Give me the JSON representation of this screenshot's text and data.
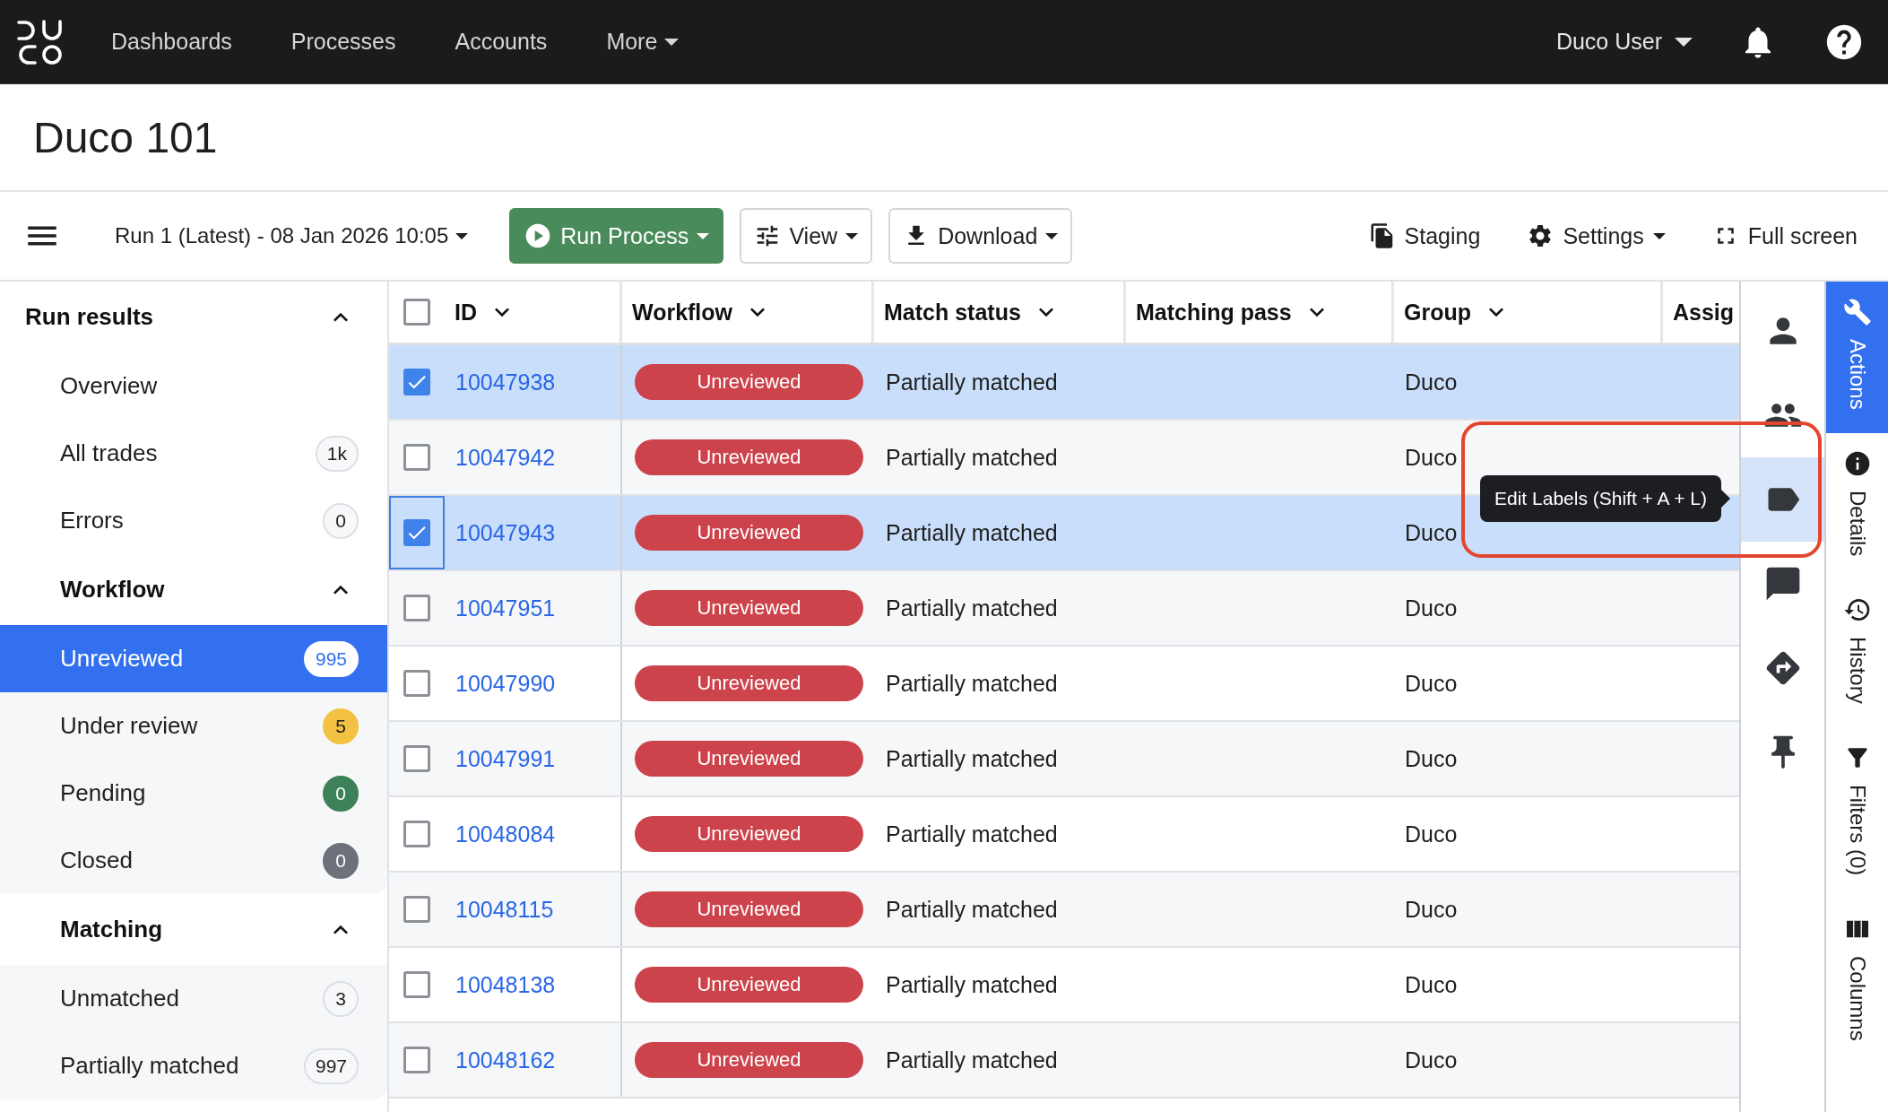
{
  "top_nav": {
    "links": [
      {
        "label": "Dashboards",
        "has_menu": false
      },
      {
        "label": "Processes",
        "has_menu": false
      },
      {
        "label": "Accounts",
        "has_menu": false
      },
      {
        "label": "More",
        "has_menu": true
      }
    ],
    "user_menu": {
      "label": "Duco User",
      "has_menu": true
    }
  },
  "page_title": "Duco 101",
  "toolbar": {
    "run_selector": {
      "label": "Run 1 (Latest) - 08 Jan 2026 10:05",
      "has_menu": true
    },
    "buttons": [
      {
        "label": "Run Process",
        "kind": "primary",
        "has_menu": true
      },
      {
        "label": "View",
        "kind": "outline",
        "has_menu": true
      },
      {
        "label": "Download",
        "kind": "outline",
        "has_menu": true
      }
    ],
    "actions": [
      {
        "label": "Staging",
        "has_menu": false
      },
      {
        "label": "Settings",
        "has_menu": true
      },
      {
        "label": "Full screen",
        "has_menu": false
      }
    ]
  },
  "sidebar": {
    "title": "Run results",
    "expanded": true,
    "children": [
      {
        "kind": "item",
        "label": "Overview",
        "selected": false
      },
      {
        "kind": "item",
        "label": "All trades",
        "count": "1k",
        "selected": false
      },
      {
        "kind": "item",
        "label": "Errors",
        "count": "0",
        "selected": false
      },
      {
        "kind": "group",
        "label": "Workflow",
        "expanded": true,
        "children": [
          {
            "kind": "item",
            "label": "Unreviewed",
            "count": "995",
            "selected": true
          },
          {
            "kind": "item",
            "label": "Under review",
            "count": "5",
            "color": "#f4c242",
            "selected": false
          },
          {
            "kind": "item",
            "label": "Pending",
            "count": "0",
            "color": "#3d8158",
            "selected": false
          },
          {
            "kind": "item",
            "label": "Closed",
            "count": "0",
            "color": "#6c717a",
            "selected": false
          }
        ]
      },
      {
        "kind": "group",
        "label": "Matching",
        "expanded": true,
        "children": [
          {
            "kind": "item",
            "label": "Unmatched",
            "count": "3",
            "selected": false
          },
          {
            "kind": "item",
            "label": "Partially matched",
            "count": "997",
            "selected": false
          }
        ]
      }
    ]
  },
  "table": {
    "select_all": {
      "checked": false
    },
    "columns": [
      {
        "label": "ID",
        "has_menu": true
      },
      {
        "label": "Workflow",
        "has_menu": true
      },
      {
        "label": "Match status",
        "has_menu": true
      },
      {
        "label": "Matching pass",
        "has_menu": true
      },
      {
        "label": "Group",
        "has_menu": true
      },
      {
        "label": "Assig",
        "has_menu": false
      }
    ],
    "rows": [
      {
        "id": "10047938",
        "workflow": "Unreviewed",
        "match_status": "Partially matched",
        "group": "Duco",
        "selected": true,
        "focused": false
      },
      {
        "id": "10047942",
        "workflow": "Unreviewed",
        "match_status": "Partially matched",
        "group": "Duco",
        "selected": false,
        "focused": false
      },
      {
        "id": "10047943",
        "workflow": "Unreviewed",
        "match_status": "Partially matched",
        "group": "Duco",
        "selected": true,
        "focused": true
      },
      {
        "id": "10047951",
        "workflow": "Unreviewed",
        "match_status": "Partially matched",
        "group": "Duco",
        "selected": false,
        "focused": false
      },
      {
        "id": "10047990",
        "workflow": "Unreviewed",
        "match_status": "Partially matched",
        "group": "Duco",
        "selected": false,
        "focused": false
      },
      {
        "id": "10047991",
        "workflow": "Unreviewed",
        "match_status": "Partially matched",
        "group": "Duco",
        "selected": false,
        "focused": false
      },
      {
        "id": "10048084",
        "workflow": "Unreviewed",
        "match_status": "Partially matched",
        "group": "Duco",
        "selected": false,
        "focused": false
      },
      {
        "id": "10048115",
        "workflow": "Unreviewed",
        "match_status": "Partially matched",
        "group": "Duco",
        "selected": false,
        "focused": false
      },
      {
        "id": "10048138",
        "workflow": "Unreviewed",
        "match_status": "Partially matched",
        "group": "Duco",
        "selected": false,
        "focused": false
      },
      {
        "id": "10048162",
        "workflow": "Unreviewed",
        "match_status": "Partially matched",
        "group": "Duco",
        "selected": false,
        "focused": false
      }
    ]
  },
  "tool_rail": [
    {
      "highlighted": false
    },
    {
      "highlighted": false
    },
    {
      "highlighted": true
    },
    {
      "highlighted": false
    },
    {
      "highlighted": false
    },
    {
      "highlighted": false
    }
  ],
  "tooltip": {
    "text": "Edit Labels (Shift + A + L)",
    "highlighted": true
  },
  "panel_tabs": [
    {
      "label": "Actions",
      "selected": true
    },
    {
      "label": "Details",
      "selected": false
    },
    {
      "label": "History",
      "selected": false
    },
    {
      "label": "Filters (0)",
      "selected": false
    },
    {
      "label": "Columns",
      "selected": false
    }
  ]
}
